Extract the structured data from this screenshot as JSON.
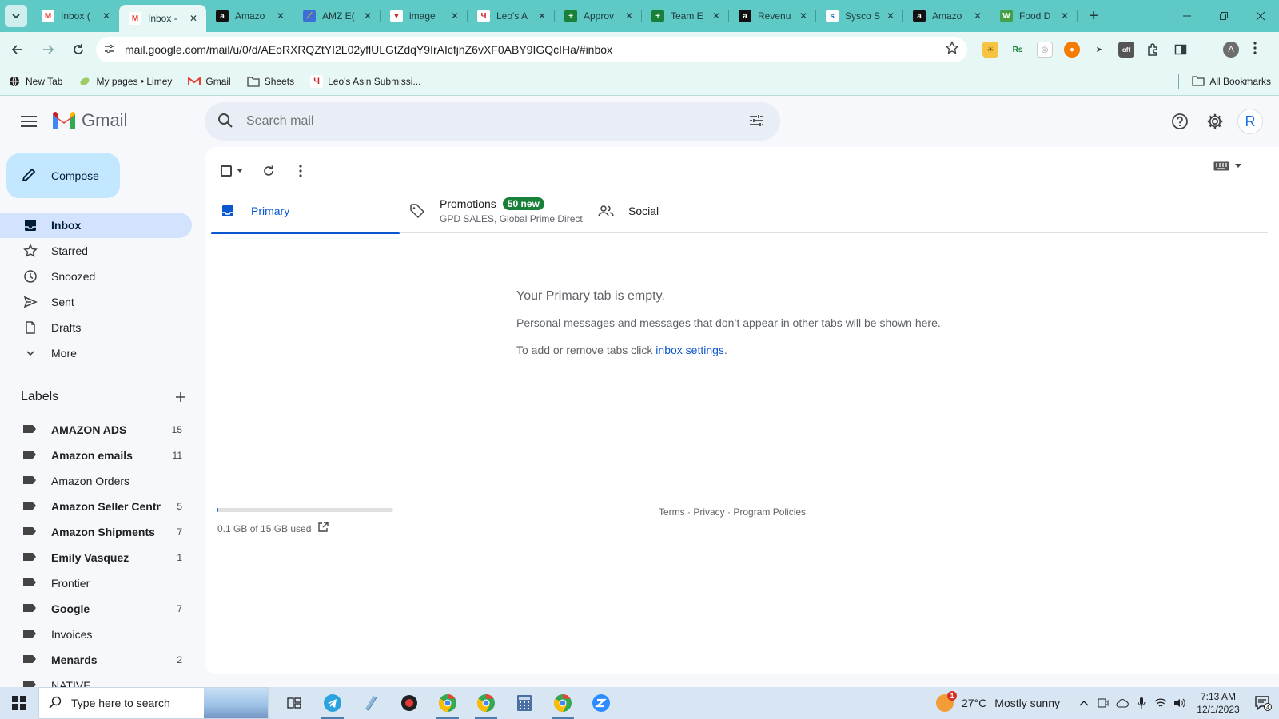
{
  "browser": {
    "tabs": [
      {
        "title": "Inbox (",
        "fav_color": "#ffffff",
        "fav_text": "M",
        "fav_fg": "#ea4335"
      },
      {
        "title": "Inbox -",
        "fav_color": "#ffffff",
        "fav_text": "M",
        "fav_fg": "#ea4335"
      },
      {
        "title": "Amazo",
        "fav_color": "#111111",
        "fav_text": "a",
        "fav_fg": "#ffffff"
      },
      {
        "title": "AMZ E(",
        "fav_color": "#3b6fd8",
        "fav_text": "⟋",
        "fav_fg": "#ffb300"
      },
      {
        "title": "image",
        "fav_color": "#ffffff",
        "fav_text": "▼",
        "fav_fg": "#c62828"
      },
      {
        "title": "Leo's A",
        "fav_color": "#ffffff",
        "fav_text": "Ч",
        "fav_fg": "#c62828"
      },
      {
        "title": "Approv",
        "fav_color": "#188038",
        "fav_text": "+",
        "fav_fg": "#ffffff"
      },
      {
        "title": "Team E",
        "fav_color": "#188038",
        "fav_text": "+",
        "fav_fg": "#ffffff"
      },
      {
        "title": "Revenu",
        "fav_color": "#111111",
        "fav_text": "a",
        "fav_fg": "#ffffff"
      },
      {
        "title": "Sysco S",
        "fav_color": "#ffffff",
        "fav_text": "s",
        "fav_fg": "#1565c0"
      },
      {
        "title": "Amazo",
        "fav_color": "#111111",
        "fav_text": "a",
        "fav_fg": "#ffffff"
      },
      {
        "title": "Food D",
        "fav_color": "#43a047",
        "fav_text": "W",
        "fav_fg": "#ffffff"
      }
    ],
    "active_tab": 1,
    "close_glyph": "✕",
    "new_tab_glyph": "+",
    "url": "mail.google.com/mail/u/0/d/AEoRXRQZtYI2L02yflULGtZdqY9IrAIcfjhZ6vXF0ABY9IGQcIHa/#inbox",
    "profile_initial": "A",
    "bookmarks": [
      {
        "label": "New Tab",
        "icon": "globe-icon"
      },
      {
        "label": "My pages • Limey",
        "icon": "limey-icon"
      },
      {
        "label": "Gmail",
        "icon": "gmail-icon"
      },
      {
        "label": "Sheets",
        "icon": "folder-icon"
      },
      {
        "label": "Leo's Asin Submissi...",
        "icon": "leo-icon"
      }
    ],
    "all_bookmarks": "All Bookmarks"
  },
  "gmail": {
    "brand": "Gmail",
    "search_placeholder": "Search mail",
    "avatar_initial": "R",
    "compose": "Compose",
    "nav": [
      {
        "label": "Inbox",
        "icon": "inbox-icon",
        "active": true
      },
      {
        "label": "Starred",
        "icon": "star-icon"
      },
      {
        "label": "Snoozed",
        "icon": "clock-icon"
      },
      {
        "label": "Sent",
        "icon": "send-icon"
      },
      {
        "label": "Drafts",
        "icon": "draft-icon"
      },
      {
        "label": "More",
        "icon": "chevron-down-icon"
      }
    ],
    "labels_title": "Labels",
    "labels": [
      {
        "name": "AMAZON ADS",
        "count": "15",
        "bold": true
      },
      {
        "name": "Amazon emails",
        "count": "11",
        "bold": true
      },
      {
        "name": "Amazon Orders",
        "count": "",
        "bold": false
      },
      {
        "name": "Amazon Seller Centr",
        "count": "5",
        "bold": true
      },
      {
        "name": "Amazon Shipments",
        "count": "7",
        "bold": true
      },
      {
        "name": "Emily Vasquez",
        "count": "1",
        "bold": true
      },
      {
        "name": "Frontier",
        "count": "",
        "bold": false
      },
      {
        "name": "Google",
        "count": "7",
        "bold": true
      },
      {
        "name": "Invoices",
        "count": "",
        "bold": false
      },
      {
        "name": "Menards",
        "count": "2",
        "bold": true
      },
      {
        "name": "NATIVE",
        "count": "",
        "bold": false
      }
    ],
    "tabs": {
      "primary": "Primary",
      "promotions": "Promotions",
      "promotions_badge": "50 new",
      "promotions_sub": "GPD SALES, Global Prime Direct",
      "social": "Social"
    },
    "empty": {
      "title": "Your Primary tab is empty.",
      "line1": "Personal messages and messages that don’t appear in other tabs will be shown here.",
      "line2_prefix": "To add or remove tabs click ",
      "line2_link": "inbox settings",
      "line2_suffix": "."
    },
    "storage": {
      "text": "0.1 GB of 15 GB used",
      "used_fraction": 0.0067
    },
    "footer": {
      "terms": "Terms",
      "privacy": "Privacy",
      "policies": "Program Policies",
      "dot": " · "
    }
  },
  "taskbar": {
    "search_placeholder": "Type here to search",
    "weather_temp": "27°C",
    "weather_text": "Mostly sunny",
    "weather_alert": "1",
    "time": "7:13 AM",
    "date": "12/1/2023",
    "notification_count": "4"
  }
}
